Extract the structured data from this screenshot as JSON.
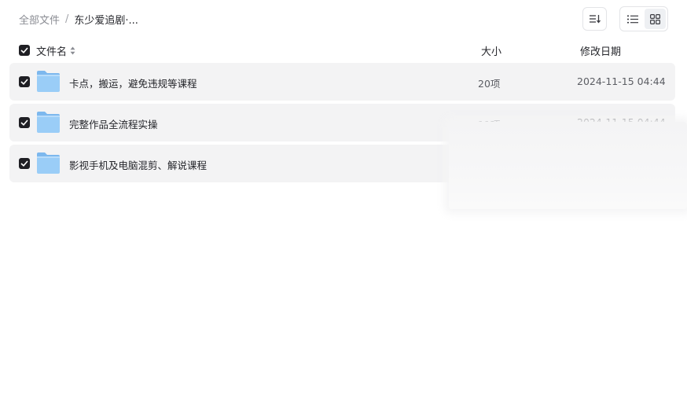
{
  "breadcrumb": {
    "root": "全部文件",
    "separator": "/",
    "current": "东少爱追剧·..."
  },
  "toolbar": {
    "sort_icon": "sort-lines-icon",
    "list_view_icon": "list-view-icon",
    "grid_view_icon": "grid-view-icon"
  },
  "table": {
    "headers": {
      "name": "文件名",
      "size": "大小",
      "date": "修改日期"
    },
    "rows": [
      {
        "name": "卡点，搬运，避免违规等课程",
        "size": "20项",
        "date": "2024-11-15 04:44",
        "checked": true
      },
      {
        "name": "完整作品全流程实操",
        "size": "11项",
        "date": "2024-11-15 04:44",
        "checked": true
      },
      {
        "name": "影视手机及电脑混剪、解说课程",
        "size": "",
        "date": "",
        "checked": true
      }
    ]
  },
  "colors": {
    "row_bg": "#f3f3f4",
    "folder_blue": "#8cc3f2",
    "checkbox": "#1f1f24"
  }
}
